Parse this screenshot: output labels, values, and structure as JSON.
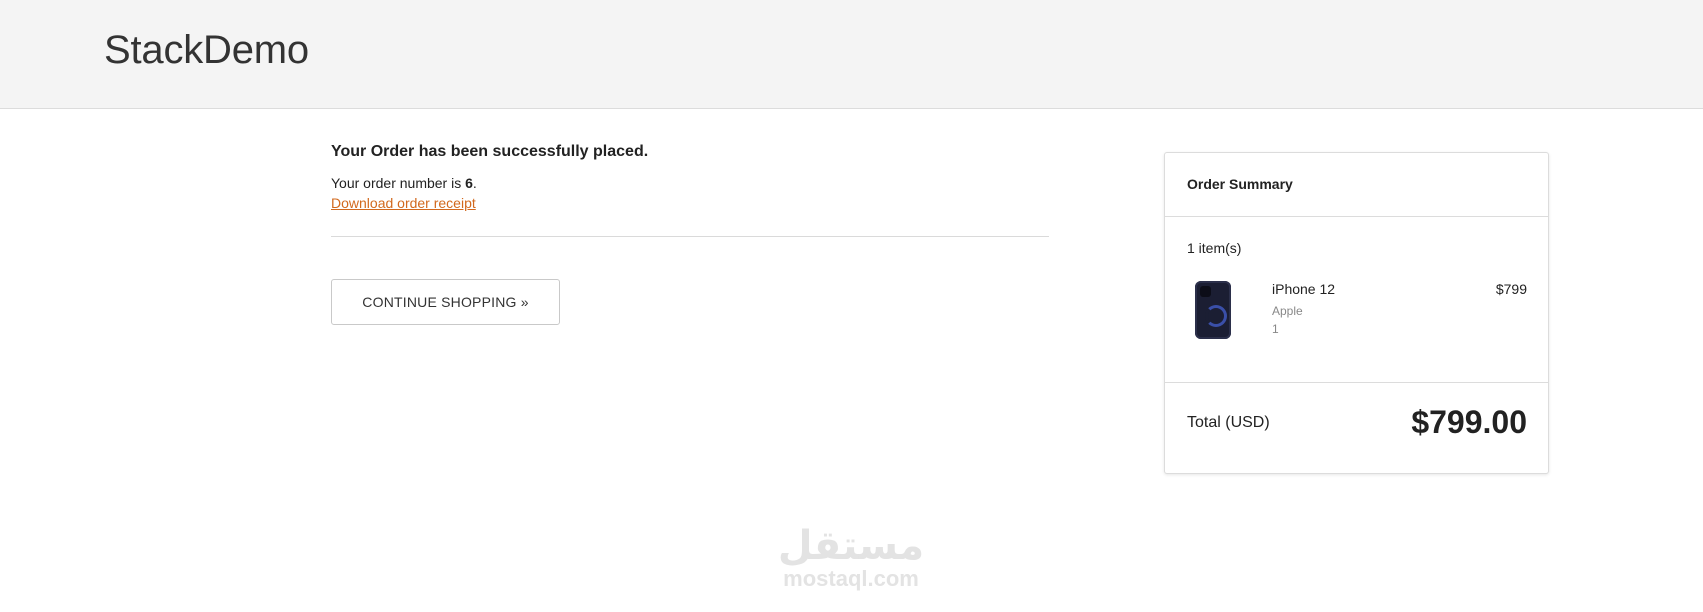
{
  "header": {
    "brand": "StackDemo"
  },
  "confirmation": {
    "title": "Your Order has been successfully placed.",
    "order_prefix": "Your order number is ",
    "order_number": "6",
    "order_suffix": ".",
    "receipt_link": "Download order receipt",
    "continue_label": "CONTINUE SHOPPING »"
  },
  "summary": {
    "title": "Order Summary",
    "item_count": "1 item(s)",
    "items": [
      {
        "name": "iPhone 12",
        "brand": "Apple",
        "quantity": "1",
        "price": "$799",
        "thumbnail_icon": "phone-icon"
      }
    ],
    "total_label": "Total (USD)",
    "total_value": "$799.00"
  },
  "watermark": {
    "arabic": "مستقل",
    "latin": "mostaql.com"
  },
  "colors": {
    "header_bg": "#f4f4f4",
    "link": "#d2691e",
    "border": "#dcdcdc"
  }
}
